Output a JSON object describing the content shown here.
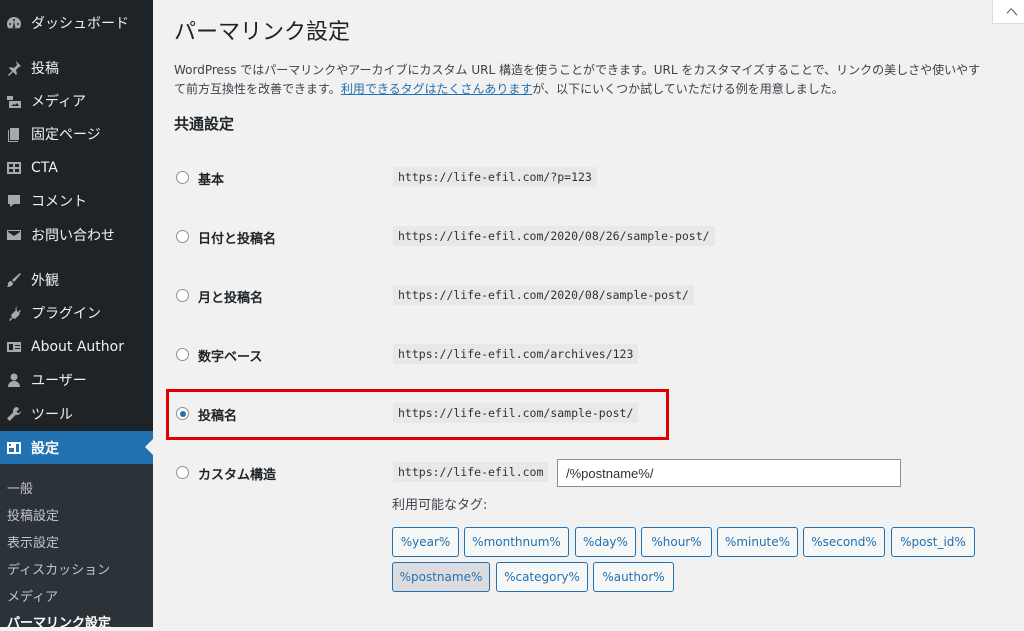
{
  "sidebar": {
    "items": [
      {
        "label": "ダッシュボード",
        "icon": "dashboard-icon"
      },
      {
        "label": "投稿",
        "icon": "pin-icon"
      },
      {
        "label": "メディア",
        "icon": "media-icon"
      },
      {
        "label": "固定ページ",
        "icon": "page-icon"
      },
      {
        "label": "CTA",
        "icon": "table-icon"
      },
      {
        "label": "コメント",
        "icon": "comment-icon"
      },
      {
        "label": "お問い合わせ",
        "icon": "mail-icon"
      },
      {
        "label": "外観",
        "icon": "brush-icon"
      },
      {
        "label": "プラグイン",
        "icon": "plugin-icon"
      },
      {
        "label": "About Author",
        "icon": "id-card-icon"
      },
      {
        "label": "ユーザー",
        "icon": "user-icon"
      },
      {
        "label": "ツール",
        "icon": "wrench-icon"
      },
      {
        "label": "設定",
        "icon": "settings-icon"
      }
    ],
    "submenu": [
      "一般",
      "投稿設定",
      "表示設定",
      "ディスカッション",
      "メディア",
      "パーマリンク設定"
    ]
  },
  "help_tab": "ヘ",
  "main": {
    "title": "パーマリンク設定",
    "description_line1": "WordPress ではパーマリンクやアーカイブにカスタム URL 構造を使うことができます。URL をカスタマイズすることで、リンクの美しさや使いやす",
    "description_line2_pre": "て前方互換性を改善できます。",
    "description_link": "利用できるタグはたくさんあります",
    "description_line2_post": "が、以下にいくつか試していただける例を用意しました。",
    "section_title": "共通設定",
    "options": [
      {
        "label": "基本",
        "url": "https://life-efil.com/?p=123",
        "checked": false
      },
      {
        "label": "日付と投稿名",
        "url": "https://life-efil.com/2020/08/26/sample-post/",
        "checked": false
      },
      {
        "label": "月と投稿名",
        "url": "https://life-efil.com/2020/08/sample-post/",
        "checked": false
      },
      {
        "label": "数字ベース",
        "url": "https://life-efil.com/archives/123",
        "checked": false
      },
      {
        "label": "投稿名",
        "url": "https://life-efil.com/sample-post/",
        "checked": true
      },
      {
        "label": "カスタム構造",
        "url": "https://life-efil.com",
        "checked": false
      }
    ],
    "custom_value": "/%postname%/",
    "tags_label": "利用可能なタグ:",
    "tags": [
      "%year%",
      "%monthnum%",
      "%day%",
      "%hour%",
      "%minute%",
      "%second%",
      "%post_id%",
      "%postname%",
      "%category%",
      "%author%"
    ]
  }
}
